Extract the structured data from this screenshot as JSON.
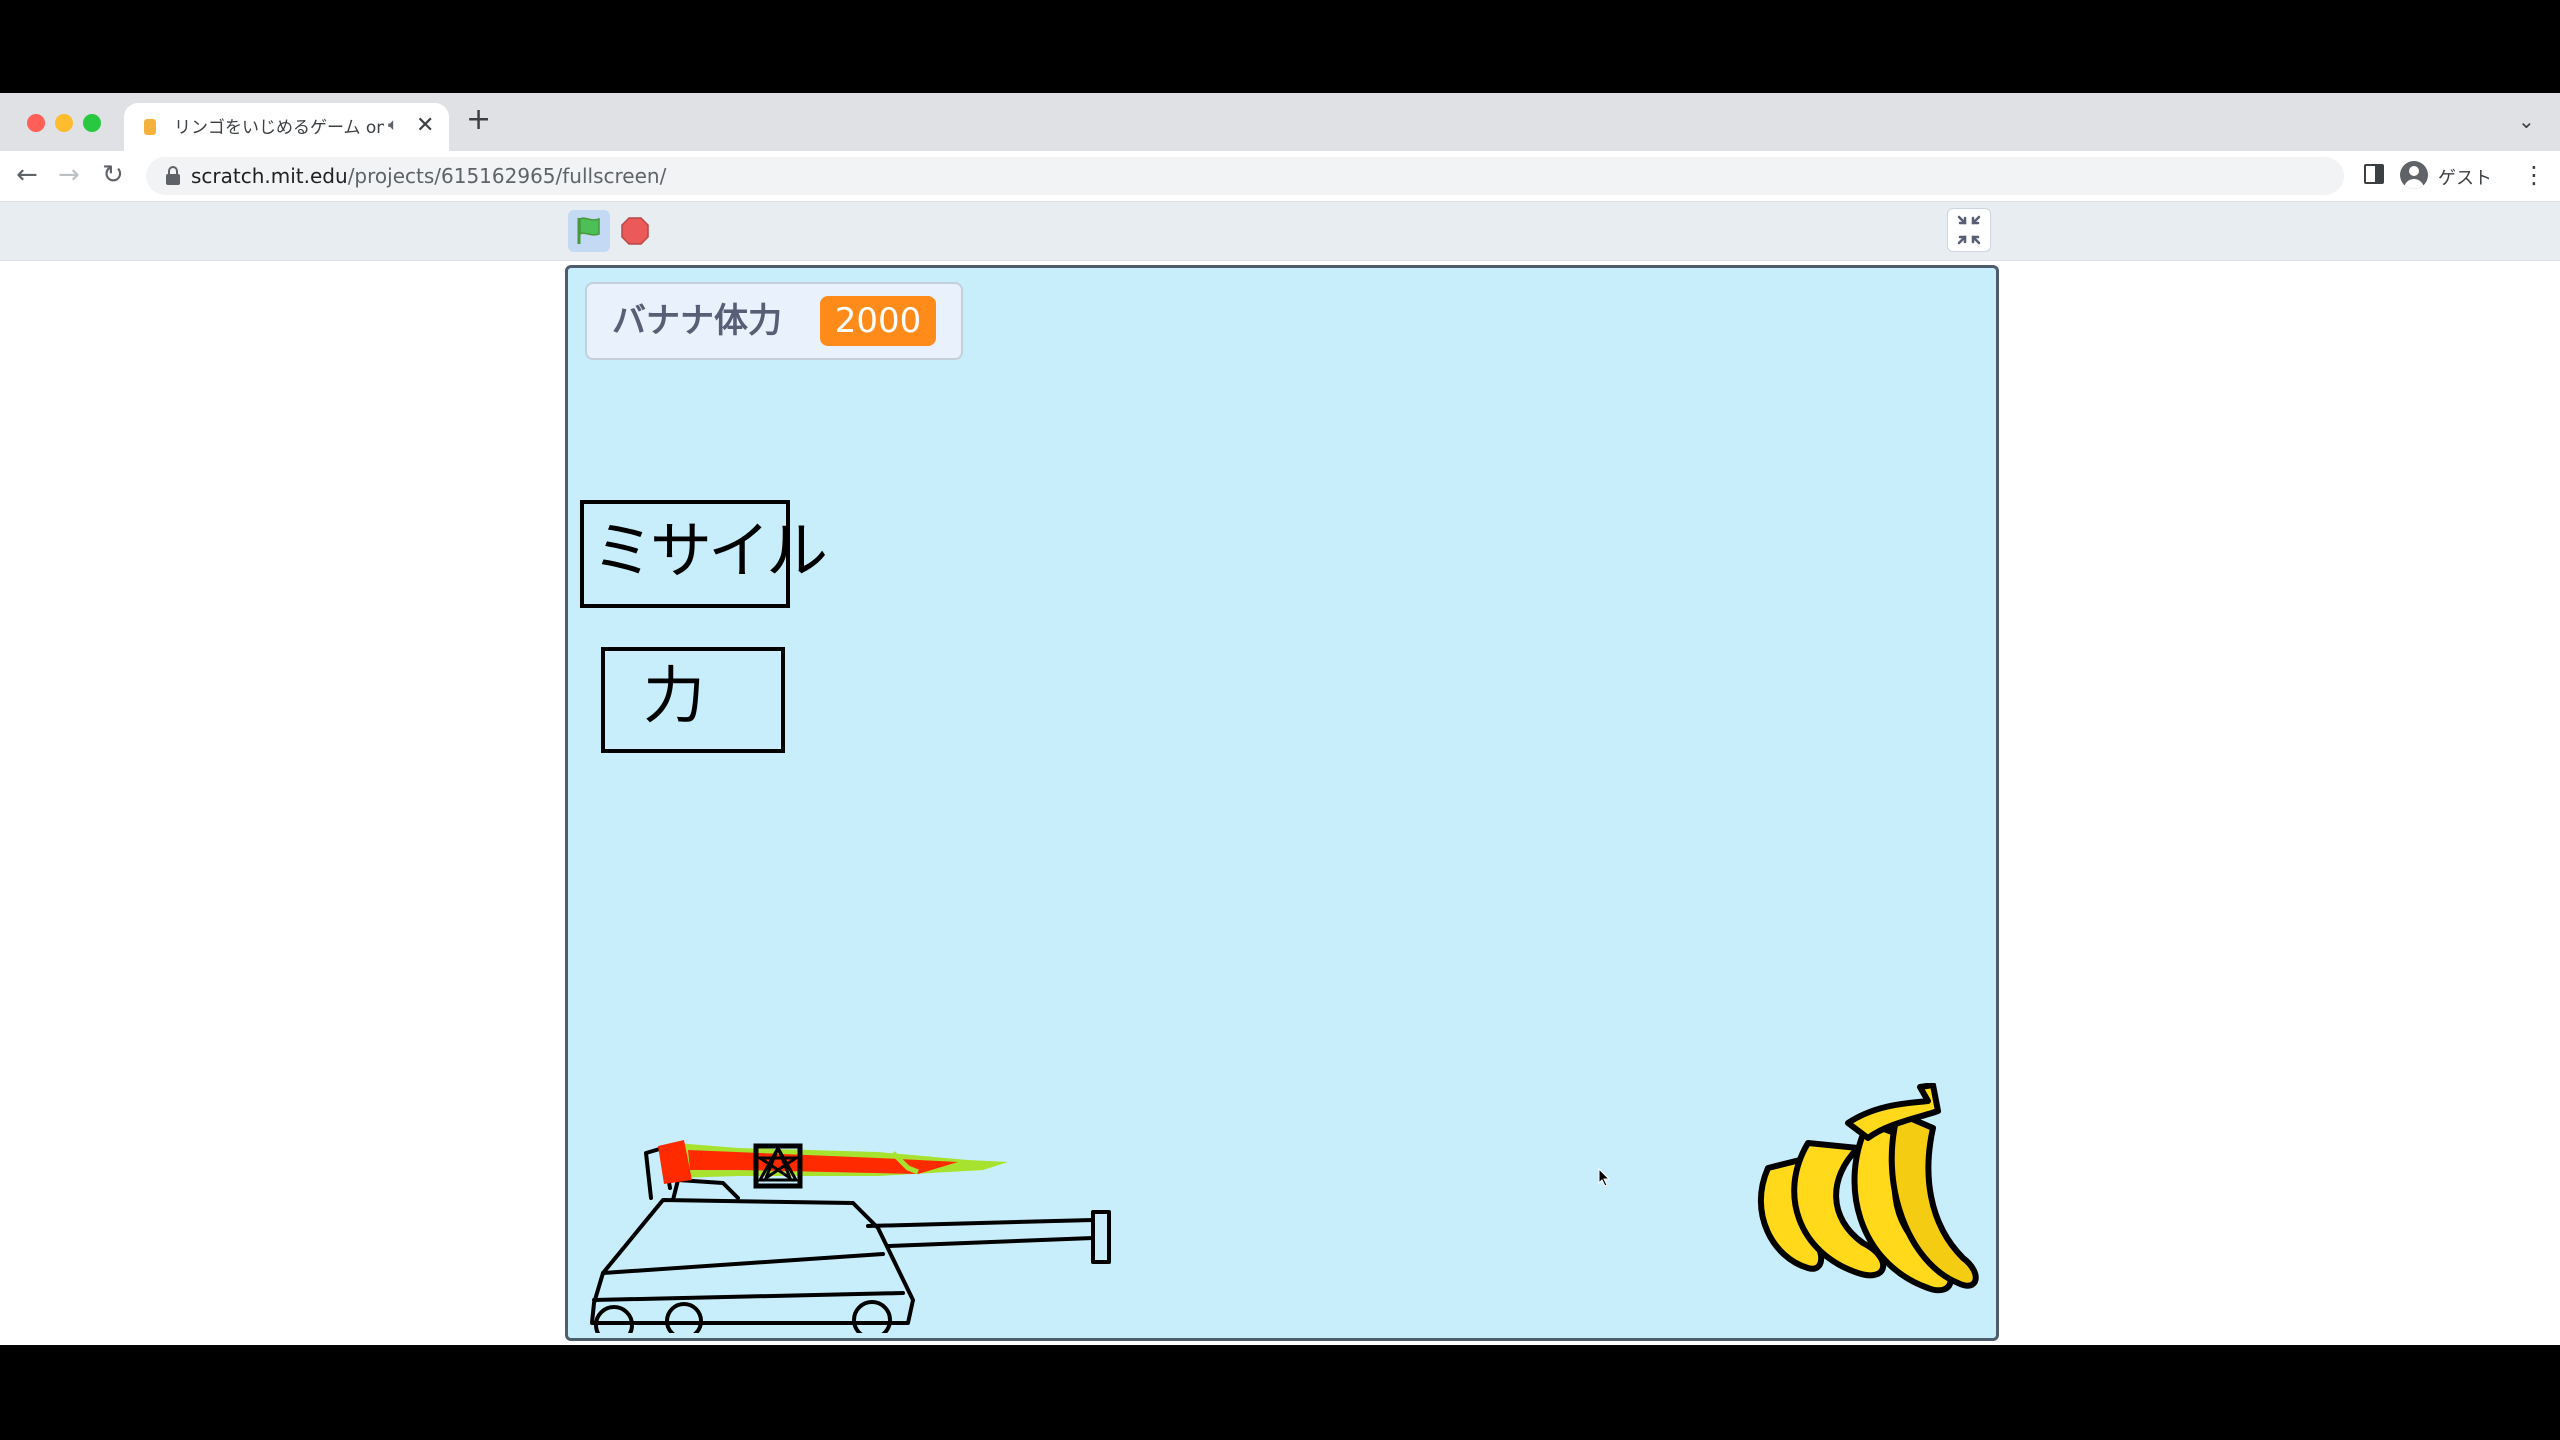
{
  "browser": {
    "tab": {
      "title": "リンゴをいじめるゲーム on Scratch"
    },
    "url": {
      "host": "scratch.mit.edu",
      "path": "/projects/615162965/fullscreen/"
    },
    "profile": {
      "label": "ゲスト"
    }
  },
  "player": {
    "monitor": {
      "label": "バナナ体力",
      "value": "2000"
    },
    "signs": {
      "missile": "ミサイル",
      "power": "力"
    }
  },
  "colors": {
    "stage_bg": "#c9eefb",
    "monitor_value_bg": "#ff8c1a",
    "flag": "#4cbf56",
    "stop": "#ec5959"
  }
}
